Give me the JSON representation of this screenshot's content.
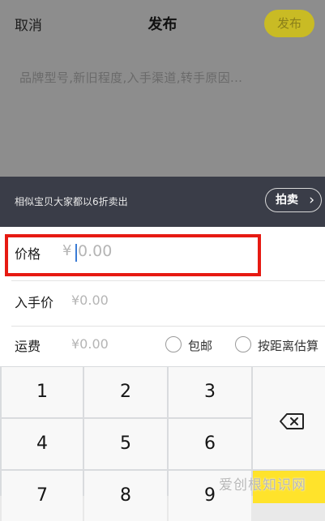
{
  "nav": {
    "cancel_label": "取消",
    "title": "发布",
    "publish_label": "发布"
  },
  "composer": {
    "placeholder": "品牌型号,新旧程度,入手渠道,转手原因..."
  },
  "banner": {
    "text": "相似宝贝大家都以6折卖出",
    "auction_label": "拍卖"
  },
  "form": {
    "price": {
      "label": "价格",
      "currency": "¥",
      "placeholder": "0.00"
    },
    "original_price": {
      "label": "入手价",
      "value": "¥0.00"
    },
    "shipping": {
      "label": "运费",
      "value": "¥0.00",
      "options": [
        {
          "label": "包邮",
          "selected": false
        },
        {
          "label": "按距离估算",
          "selected": false
        }
      ]
    }
  },
  "keypad": {
    "keys": [
      "1",
      "2",
      "3",
      "4",
      "5",
      "6",
      "7",
      "8",
      "9"
    ],
    "delete_icon": "backspace-icon"
  },
  "watermark": "爱创根知识网",
  "colors": {
    "accent_yellow": "#ffe32b",
    "highlight_red": "#e61a12",
    "banner_bg": "#3a3d48",
    "caret_blue": "#3a7bd5"
  }
}
